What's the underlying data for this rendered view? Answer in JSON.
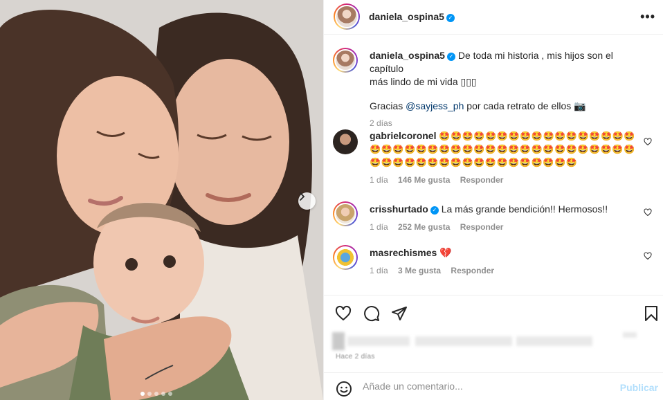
{
  "post": {
    "author": "daniela_ospina5",
    "caption_line1": "De toda mi historia , mis hijos son el capítulo",
    "caption_line2": "más lindo de mi vida ▯▯▯",
    "thanks_prefix": "Gracias ",
    "thanks_mention": "@sayjess_ph",
    "thanks_suffix": " por cada retrato de ellos 📷",
    "age": "2 días"
  },
  "comments": [
    {
      "username": "gabrielcoronel",
      "verified": true,
      "text": "🤩🤩🤩🤩🤩🤩🤩🤩🤩🤩🤩🤩🤩🤩🤩🤩🤩🤩🤩🤩🤩🤩🤩🤩🤩🤩🤩🤩🤩🤩🤩🤩🤩🤩🤩🤩🤩🤩🤩🤩🤩🤩🤩🤩🤩🤩🤩🤩🤩🤩🤩🤩🤩🤩🤩🤩🤩🤩",
      "time": "1 día",
      "likes": "146 Me gusta",
      "reply": "Responder"
    },
    {
      "username": "crisshurtado",
      "verified": true,
      "text": "La más grande bendición!! Hermosos!!",
      "time": "1 día",
      "likes": "252 Me gusta",
      "reply": "Responder"
    },
    {
      "username": "masrechismes",
      "verified": false,
      "text": "💔",
      "time": "1 día",
      "likes": "3 Me gusta",
      "reply": "Responder"
    }
  ],
  "footer": {
    "ago": "Hace 2 días",
    "comment_placeholder": "Añade un comentario...",
    "publish": "Publicar"
  },
  "carousel": {
    "slides": 5,
    "active_index": 0
  },
  "colors": {
    "verified": "#0095f6",
    "mention": "#00376b",
    "muted": "#8e8e8e",
    "publish_disabled": "#b2dffc"
  },
  "icons": [
    "heart-icon",
    "comment-icon",
    "share-icon",
    "bookmark-icon",
    "emoji-icon",
    "more-icon",
    "chevron-right-icon",
    "verified-icon"
  ]
}
